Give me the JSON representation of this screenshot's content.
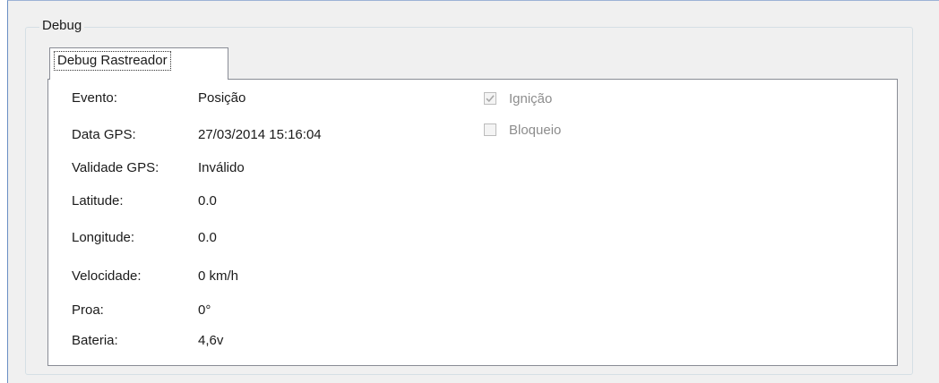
{
  "groupbox": {
    "title": "Debug"
  },
  "tab": {
    "label": "Debug Rastreador"
  },
  "fields": [
    {
      "label": "Evento:",
      "value": "Posição"
    },
    {
      "label": "Data GPS:",
      "value": "27/03/2014 15:16:04"
    },
    {
      "label": "Validade GPS:",
      "value": "Inválido"
    },
    {
      "label": "Latitude:",
      "value": "0.0"
    },
    {
      "label": "Longitude:",
      "value": "0.0"
    },
    {
      "label": "Velocidade:",
      "value": "0 km/h"
    },
    {
      "label": "Proa:",
      "value": "0°"
    },
    {
      "label": "Bateria:",
      "value": "4,6v"
    }
  ],
  "checkboxes": [
    {
      "label": "Ignição",
      "checked": true,
      "enabled": false
    },
    {
      "label": "Bloqueio",
      "checked": false,
      "enabled": false
    }
  ],
  "colors": {
    "window_background": "#f0f0f0",
    "panel_background": "#ffffff",
    "disabled_text": "#8d8d8d",
    "border": "#898c95"
  }
}
